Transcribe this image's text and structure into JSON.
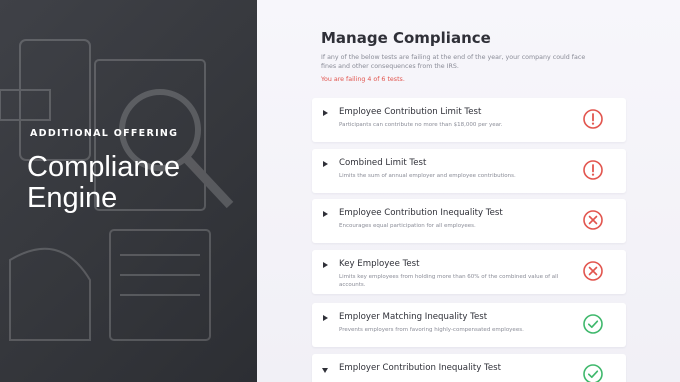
{
  "offering": {
    "eyebrow": "ADDITIONAL OFFERING",
    "title_line1": "Compliance",
    "title_line2": "Engine"
  },
  "compliance": {
    "heading": "Manage Compliance",
    "description": "If any of the below tests are failing at the end of the year, your company could face fines and other consequences from the IRS.",
    "failing_text": "You are failing 4 of 6 tests."
  },
  "colors": {
    "warning": "#e2554e",
    "fail": "#e2554e",
    "pass": "#3fb86c"
  },
  "tests": [
    {
      "title": "Employee Contribution Limit Test",
      "subtitle": "Participants can contribute no more than $18,000 per year.",
      "status": "warning",
      "status_icon": "exclamation-circle-icon",
      "expanded": false
    },
    {
      "title": "Combined Limit Test",
      "subtitle": "Limits the sum of annual employer and employee contributions.",
      "status": "warning",
      "status_icon": "exclamation-circle-icon",
      "expanded": false
    },
    {
      "title": "Employee Contribution Inequality Test",
      "subtitle": "Encourages equal participation for all employees.",
      "status": "fail",
      "status_icon": "x-circle-icon",
      "expanded": false
    },
    {
      "title": "Key Employee Test",
      "subtitle": "Limits key employees from holding more than 60% of the combined value of all accounts.",
      "status": "fail",
      "status_icon": "x-circle-icon",
      "expanded": false
    },
    {
      "title": "Employer Matching Inequality Test",
      "subtitle": "Prevents employers from favoring highly-compensated employees.",
      "status": "pass",
      "status_icon": "check-circle-icon",
      "expanded": false
    },
    {
      "title": "Employer Contribution Inequality Test",
      "subtitle": "",
      "status": "pass",
      "status_icon": "check-circle-icon",
      "expanded": true
    }
  ]
}
